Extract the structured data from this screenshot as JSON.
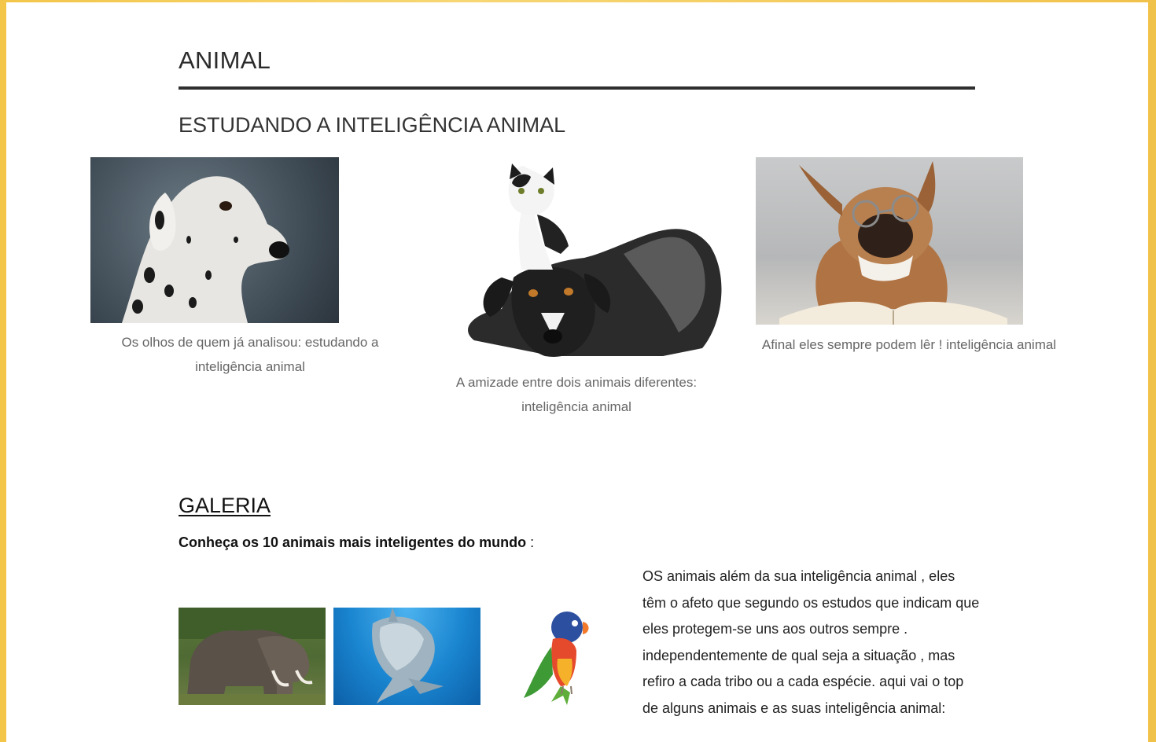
{
  "site": {
    "title": "ANIMAL"
  },
  "section": {
    "heading": "ESTUDANDO A INTELIGÊNCIA ANIMAL"
  },
  "figures": [
    {
      "icon": "dalmatian-photo",
      "caption": "Os olhos de quem já analisou: estudando a inteligência animal"
    },
    {
      "icon": "dog-and-cat-photo",
      "caption": "A amizade entre dois animais diferentes: inteligência animal"
    },
    {
      "icon": "bulldog-reading-photo",
      "caption": "Afinal eles sempre podem lêr ! inteligência animal"
    }
  ],
  "gallery": {
    "heading": "GALERIA",
    "intro_bold": "Conheça os 10 animais mais inteligentes do mundo",
    "intro_suffix": " :",
    "images": [
      {
        "icon": "elephants-photo"
      },
      {
        "icon": "dolphin-photo"
      },
      {
        "icon": "parrot-photo"
      }
    ],
    "body": "OS animais além da sua inteligência animal , eles têm o afeto que segundo os estudos que indicam que eles protegem-se uns aos outros sempre . independentemente de qual seja a situação , mas refiro a cada tribo ou a cada espécie. aqui vai o top de alguns animais e as suas inteligência animal:"
  },
  "colors": {
    "page_frame": "#f3c64a",
    "title_rule": "#2f2f2f",
    "caption": "#666666"
  }
}
